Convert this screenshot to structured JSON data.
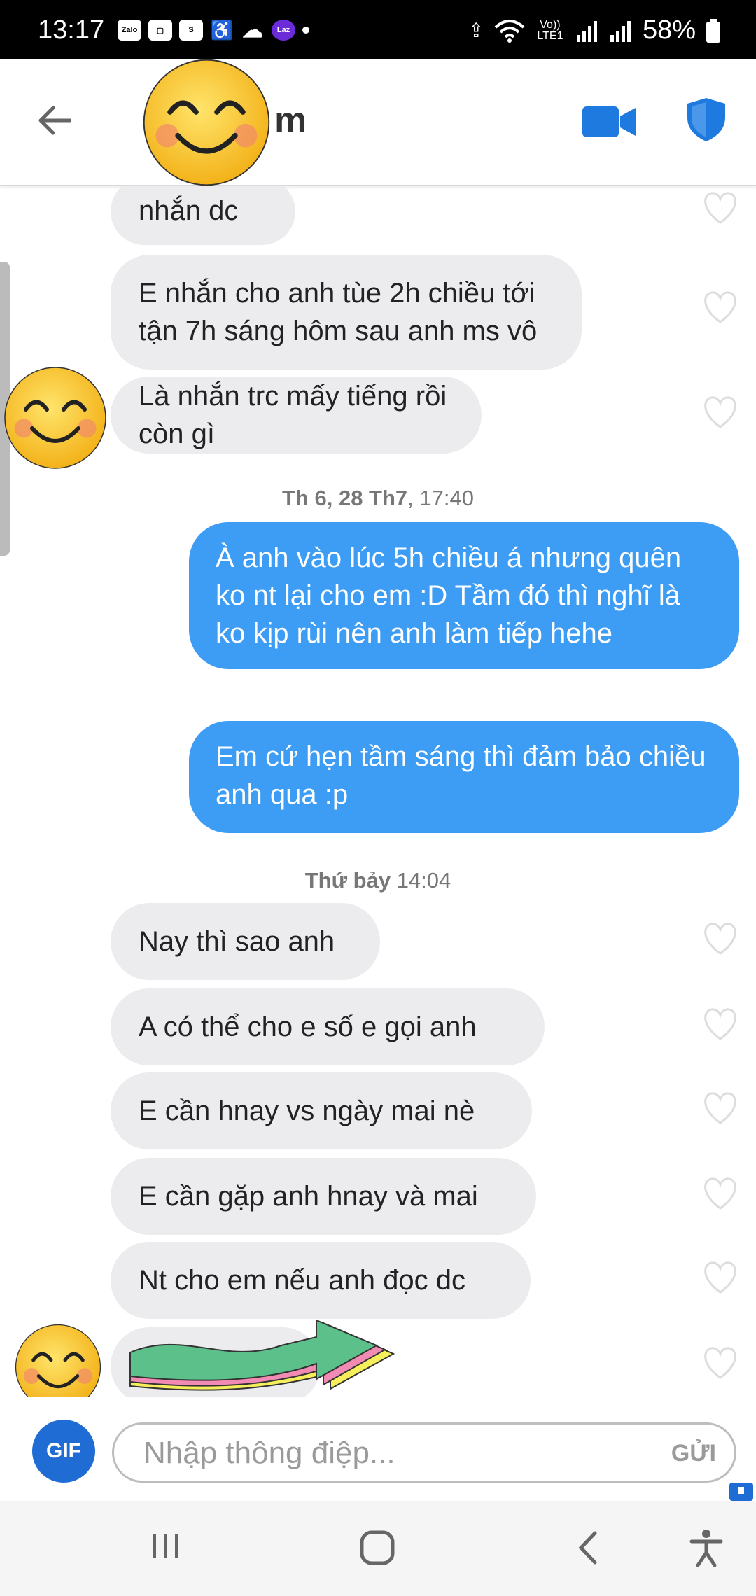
{
  "status_bar": {
    "time": "13:17",
    "app_icons": [
      "Zalo",
      "",
      "S",
      "",
      "",
      "Laz"
    ],
    "network": "Vo)) LTE1",
    "battery": "58%"
  },
  "header": {
    "contact_name_visible": "m"
  },
  "chat": {
    "messages": [
      {
        "dir": "in",
        "text": "Mà e nhắn dc"
      },
      {
        "dir": "in",
        "text": "E nhắn cho anh tùe 2h chiều tới tận 7h sáng hôm sau anh ms vô"
      },
      {
        "dir": "in",
        "text": "Là nhắn trc mấy tiếng rồi còn gì"
      }
    ],
    "stamp1_bold": "Th 6, 28 Th7",
    "stamp1_time": ", 17:40",
    "out_messages": [
      "À anh vào lúc 5h chiều á nhưng quên ko nt lại cho em :D Tầm đó thì nghĩ là ko kịp rùi nên anh làm tiếp hehe",
      "Em cứ hẹn tầm sáng thì đảm bảo chiều anh qua :p"
    ],
    "stamp2_bold": "Thứ bảy",
    "stamp2_time": " 14:04",
    "messages2": [
      "Nay thì sao anh",
      "A có thể cho e số e gọi anh",
      "E cần hnay vs ngày mai nè",
      "E cần gặp anh hnay và mai",
      "Nt cho em nếu anh đọc dc"
    ]
  },
  "input": {
    "gif_label": "GIF",
    "placeholder": "Nhập thông điệp...",
    "send_label": "GỬI"
  },
  "colors": {
    "outgoing": "#3d9cf4",
    "incoming": "#ececef",
    "accent": "#1f6cd4"
  }
}
